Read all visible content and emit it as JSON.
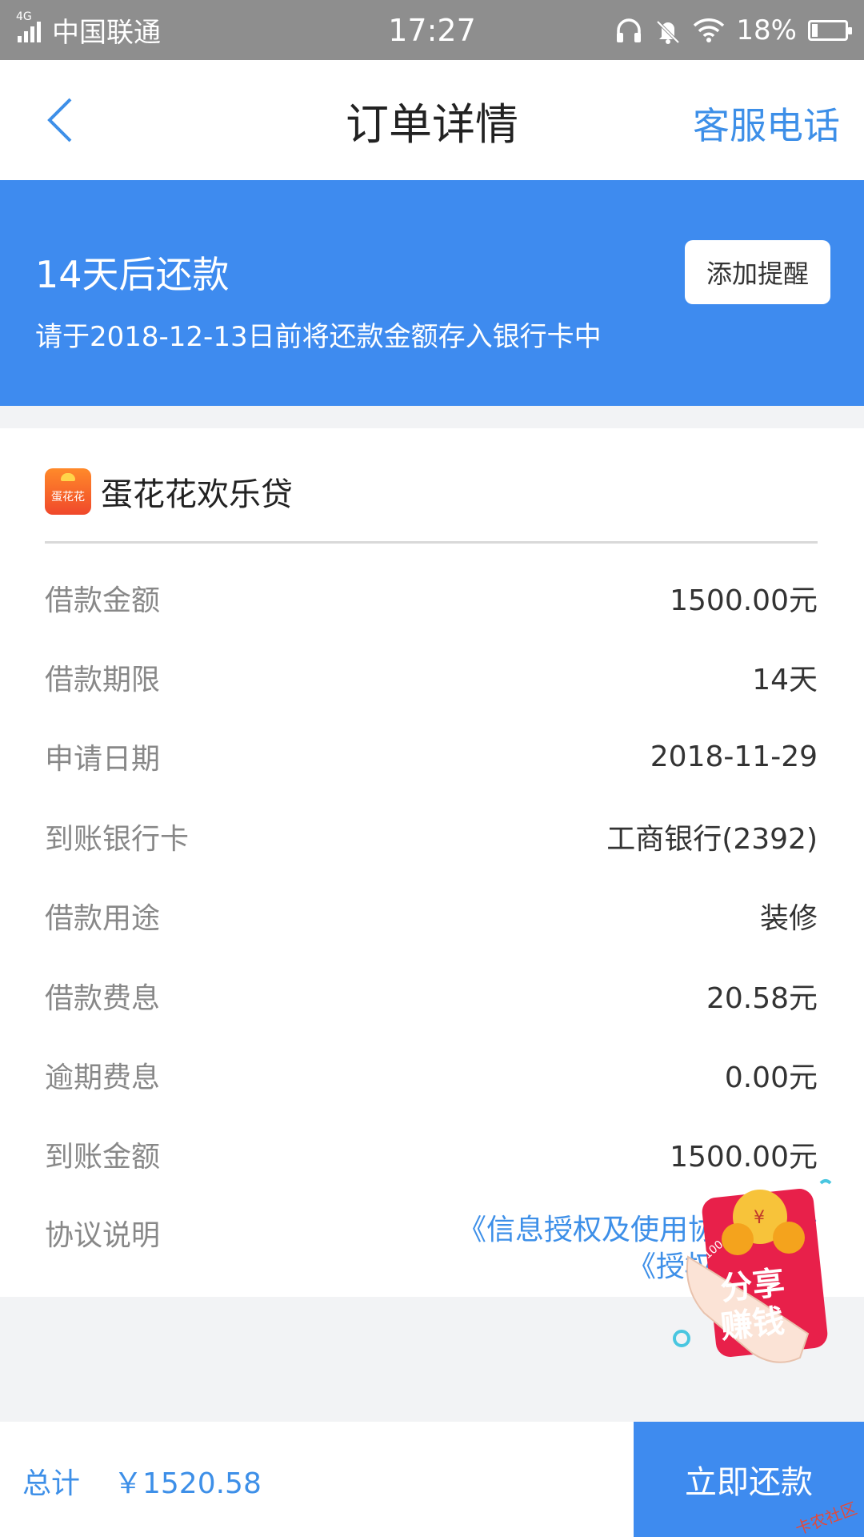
{
  "status_bar": {
    "network": "4G",
    "carrier": "中国联通",
    "time": "17:27",
    "battery": "18%",
    "battery_level": 0.18,
    "icons": [
      "signal-icon",
      "headphones-icon",
      "bell-muted-icon",
      "wifi-icon",
      "battery-icon"
    ]
  },
  "nav": {
    "title": "订单详情",
    "right_action": "客服电话",
    "back_icon": "chevron-left-icon"
  },
  "banner": {
    "title": "14天后还款",
    "subtitle": "请于2018-12-13日前将还款金额存入银行卡中",
    "remind_button": "添加提醒"
  },
  "product": {
    "logo_text": "蛋花花",
    "name": "蛋花花欢乐贷"
  },
  "details": [
    {
      "label": "借款金额",
      "value": "1500.00元"
    },
    {
      "label": "借款期限",
      "value": "14天"
    },
    {
      "label": "申请日期",
      "value": "2018-11-29"
    },
    {
      "label": "到账银行卡",
      "value": "工商银行(2392)"
    },
    {
      "label": "借款用途",
      "value": "装修"
    },
    {
      "label": "借款费息",
      "value": "20.58元"
    },
    {
      "label": "逾期费息",
      "value": "0.00元"
    },
    {
      "label": "到账金额",
      "value": "1500.00元"
    }
  ],
  "agreement": {
    "label": "协议说明",
    "line1": "《信息授权及使用协议》《信",
    "line2": "《授权"
  },
  "share_badge": {
    "line1": "分享",
    "line2": "赚钱",
    "coin_text": "100"
  },
  "bottom": {
    "total_label": "总计",
    "total_value": "￥1520.58",
    "pay_button": "立即还款",
    "watermark": "卡农社区"
  },
  "colors": {
    "primary": "#3e8bef",
    "link": "#3d8fe8",
    "status_bar": "#8e8e8e",
    "background": "#f2f3f5",
    "badge_red": "#e8204a"
  }
}
